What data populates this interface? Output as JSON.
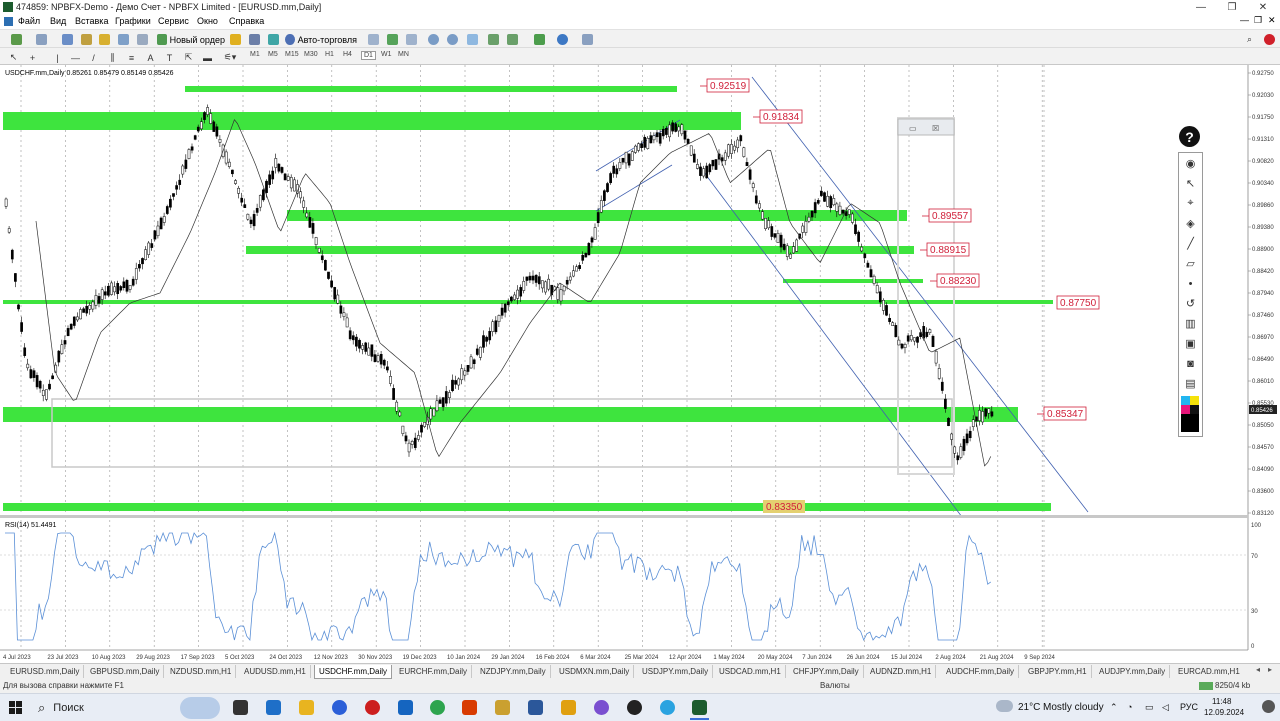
{
  "window": {
    "title": "474859: NPBFX-Demo - Демо Счет - NPBFX Limited - [EURUSD.mm,Daily]",
    "minimize": "—",
    "restore": "❐",
    "close": "✕"
  },
  "menu": [
    "Файл",
    "Вид",
    "Вставка",
    "Графики",
    "Сервис",
    "Окно",
    "Справка"
  ],
  "toolbar": {
    "new_order": "Новый ордер",
    "auto_trading": "Авто-торговля",
    "timeframes": [
      "M1",
      "M5",
      "M15",
      "M30",
      "H1",
      "H4",
      "D1",
      "W1",
      "MN"
    ],
    "active_timeframe": "D1"
  },
  "chart": {
    "header": "USDCHF.mm,Daily  0.85261 0.85479 0.85149 0.85426",
    "indicator_label": "RSI(14) 51.4491",
    "level_labels": {
      "l92519": "0.92519",
      "l91834": "0.91834",
      "l89557": "0.89557",
      "l88915": "0.88915",
      "l88230": "0.88230",
      "l87750": "0.87750",
      "l85347": "0.85347",
      "l83350": "0.83350"
    },
    "price_axis": [
      "0.92750",
      "0.92030",
      "0.91750",
      "0.91310",
      "0.90820",
      "0.90340",
      "0.89860",
      "0.89380",
      "0.88900",
      "0.88420",
      "0.87940",
      "0.87460",
      "0.86970",
      "0.86490",
      "0.86010",
      "0.85530",
      "0.85050",
      "0.84570",
      "0.84090",
      "0.83600",
      "0.83120"
    ],
    "current_price": "0.85426",
    "rsi_axis": [
      "100",
      "70",
      "30",
      "0"
    ],
    "dates": [
      "4 Jul 2023",
      "23 Jul 2023",
      "10 Aug 2023",
      "29 Aug 2023",
      "17 Sep 2023",
      "5 Oct 2023",
      "24 Oct 2023",
      "12 Nov 2023",
      "30 Nov 2023",
      "19 Dec 2023",
      "10 Jan 2024",
      "29 Jan 2024",
      "16 Feb 2024",
      "6 Mar 2024",
      "25 Mar 2024",
      "12 Apr 2024",
      "1 May 2024",
      "20 May 2024",
      "7 Jun 2024",
      "26 Jun 2024",
      "15 Jul 2024",
      "2 Aug 2024",
      "21 Aug 2024",
      "9 Sep 2024"
    ]
  },
  "tabs": [
    {
      "label": "EURUSD.mm,Daily",
      "active": false
    },
    {
      "label": "GBPUSD.mm,Daily",
      "active": false
    },
    {
      "label": "NZDUSD.mm,H1",
      "active": false
    },
    {
      "label": "AUDUSD.mm,H1",
      "active": false
    },
    {
      "label": "USDCHF.mm,Daily",
      "active": true
    },
    {
      "label": "EURCHF.mm,Daily",
      "active": false
    },
    {
      "label": "NZDJPY.mm,Daily",
      "active": false
    },
    {
      "label": "USDMXN.mm,Daily",
      "active": false
    },
    {
      "label": "USDJPY.mm,Daily",
      "active": false
    },
    {
      "label": "USDCAD.mm,H1",
      "active": false
    },
    {
      "label": "CHFJPY.mm,Daily",
      "active": false
    },
    {
      "label": "AUDNZD.mm,H1",
      "active": false
    },
    {
      "label": "AUDCHF.mm,Daily",
      "active": false
    },
    {
      "label": "GBPJPY.mm,H1",
      "active": false
    },
    {
      "label": "AUDJPY.mm,Daily",
      "active": false
    },
    {
      "label": "EURCAD.mm,H1",
      "active": false
    }
  ],
  "status": {
    "help": "Для вызова справки нажмите F1",
    "middle": "Валюты",
    "traffic": "8250/4 kb"
  },
  "taskbar": {
    "search": "Поиск",
    "weather_temp": "21°C",
    "weather_text": "Mostly cloudy",
    "language": "РУС",
    "time": "11:48",
    "date": "12.09.2024"
  },
  "colors": {
    "level_fill": "#3ee43e",
    "label_text": "#d0203a",
    "candle": "#000000",
    "rsi": "#5a8fd6"
  }
}
